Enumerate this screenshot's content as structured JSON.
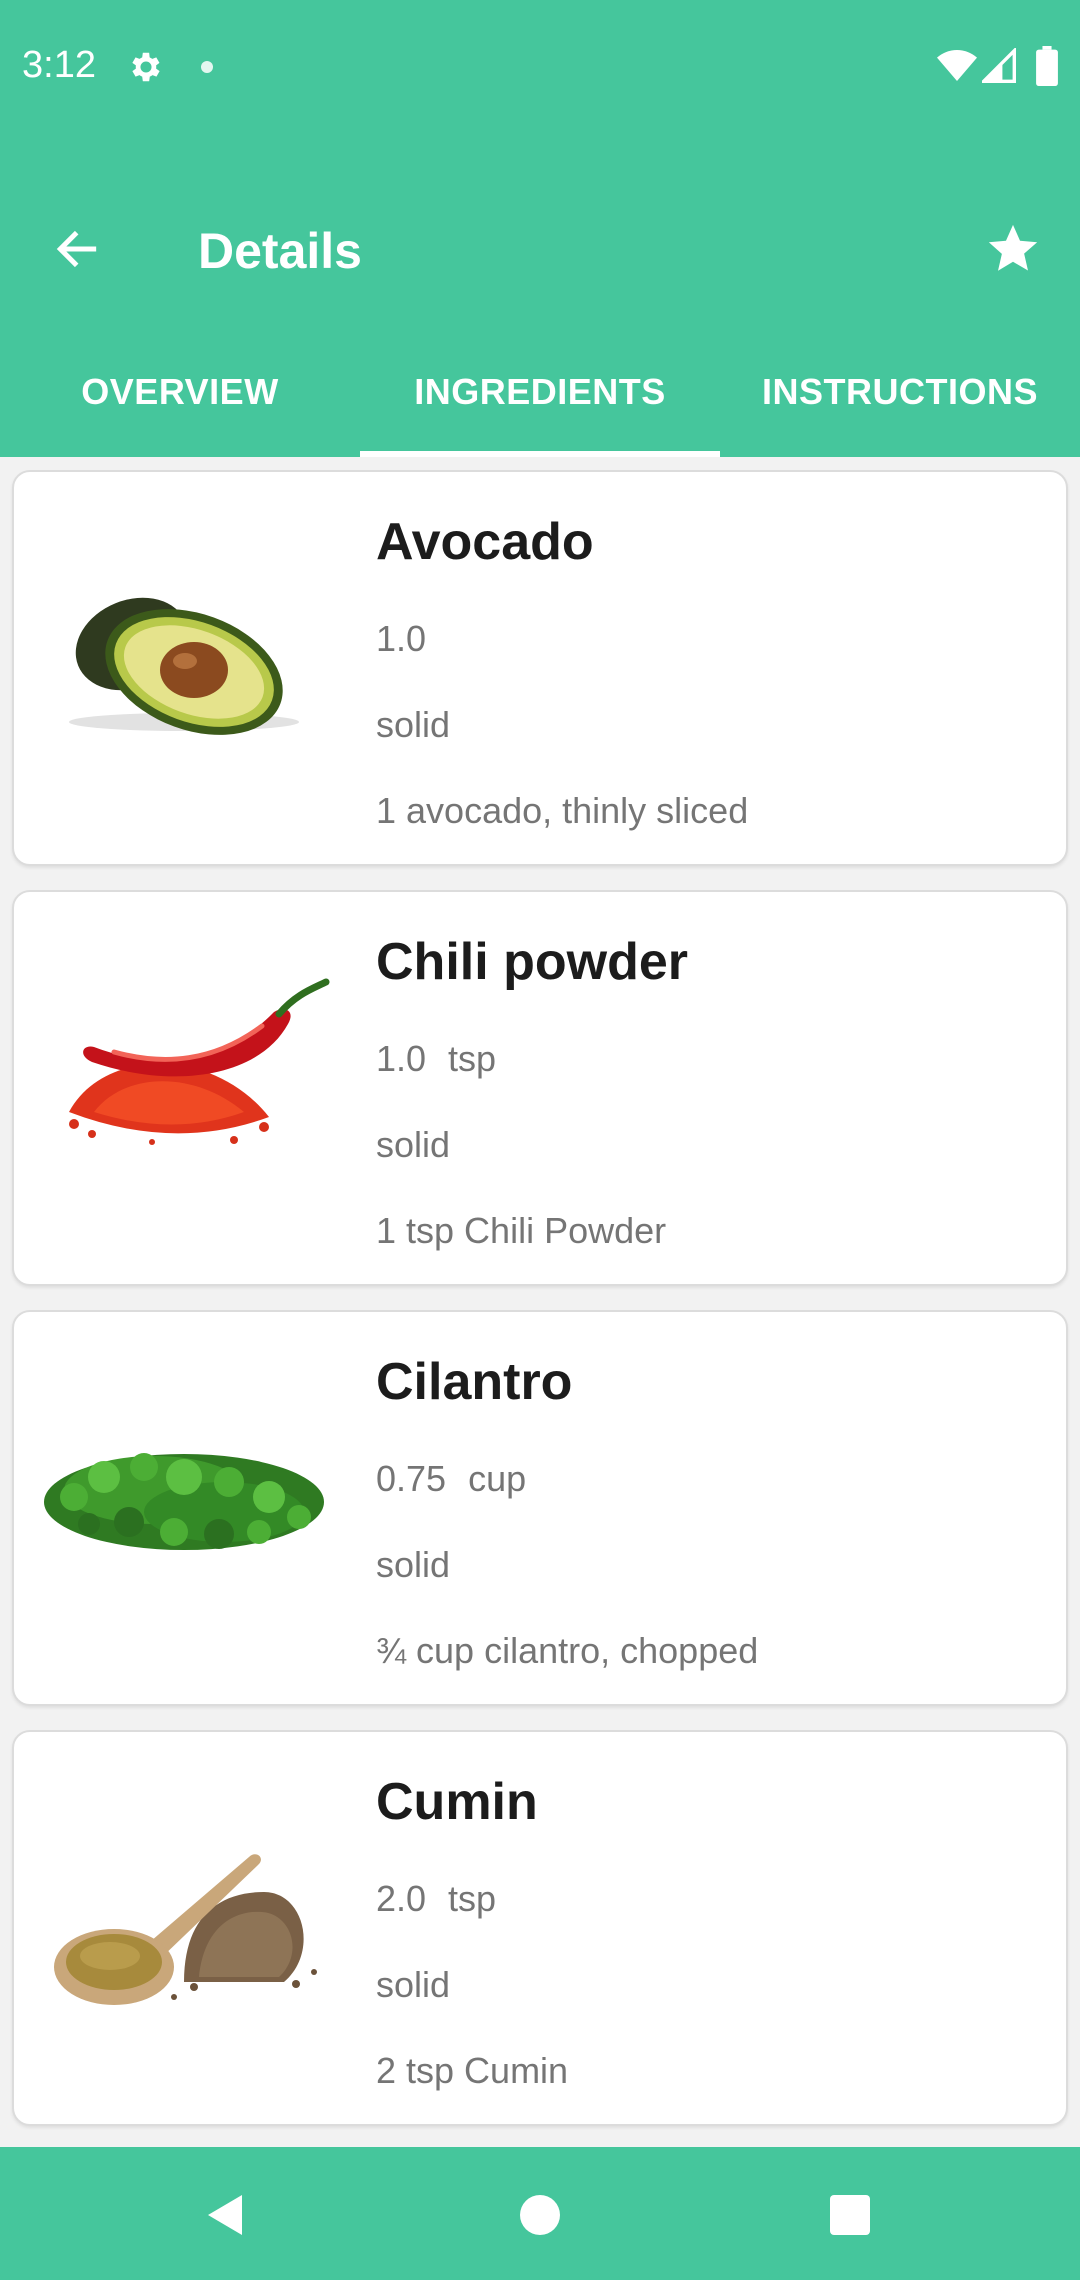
{
  "status_bar": {
    "time": "3:12"
  },
  "app_bar": {
    "title": "Details"
  },
  "tabs": [
    {
      "label": "OVERVIEW",
      "selected": false
    },
    {
      "label": "INGREDIENTS",
      "selected": true
    },
    {
      "label": "INSTRUCTIONS",
      "selected": false
    }
  ],
  "ingredients": [
    {
      "name": "Avocado",
      "amount": "1.0",
      "unit": "",
      "consistency": "solid",
      "original": "1 avocado, thinly sliced",
      "image_icon": "avocado-icon"
    },
    {
      "name": "Chili powder",
      "amount": "1.0",
      "unit": "tsp",
      "consistency": "solid",
      "original": "1 tsp Chili Powder",
      "image_icon": "chili-powder-icon"
    },
    {
      "name": "Cilantro",
      "amount": "0.75",
      "unit": "cup",
      "consistency": "solid",
      "original": "¾ cup cilantro, chopped",
      "image_icon": "cilantro-icon"
    },
    {
      "name": "Cumin",
      "amount": "2.0",
      "unit": "tsp",
      "consistency": "solid",
      "original": "2 tsp Cumin",
      "image_icon": "cumin-icon"
    }
  ],
  "colors": {
    "primary": "#45c69c",
    "background": "#f2f2f2",
    "card": "#ffffff",
    "title_text": "#1c1c1c",
    "secondary_text": "#757575"
  }
}
